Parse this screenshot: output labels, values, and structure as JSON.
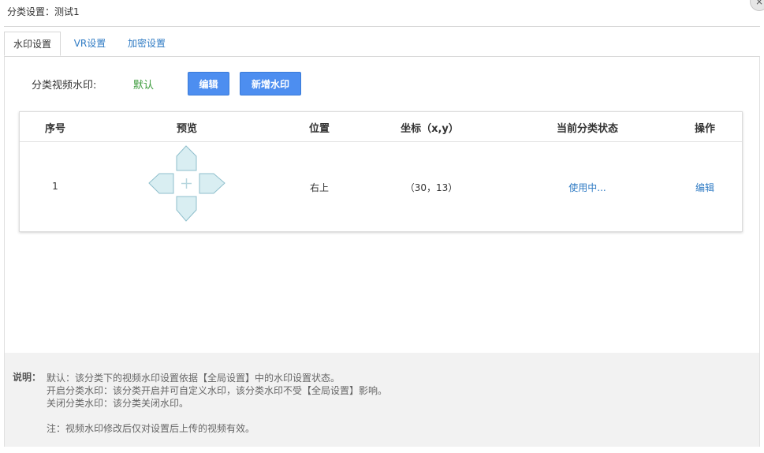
{
  "dialog": {
    "title": "分类设置：测试1",
    "close_icon": "×"
  },
  "tabs": [
    {
      "label": "水印设置",
      "active": true
    },
    {
      "label": "VR设置",
      "active": false
    },
    {
      "label": "加密设置",
      "active": false
    }
  ],
  "watermark": {
    "label": "分类视频水印:",
    "value": "默认",
    "edit_button": "编辑",
    "add_button": "新增水印"
  },
  "table": {
    "headers": [
      "序号",
      "预览",
      "位置",
      "坐标（x,y）",
      "当前分类状态",
      "操作"
    ],
    "rows": [
      {
        "index": "1",
        "preview_icon": "dpad-position-icon",
        "position": "右上",
        "coords": "（30，13）",
        "status": "使用中...",
        "action": "编辑"
      }
    ]
  },
  "notes": {
    "heading": "说明：",
    "lines": [
      "默认：该分类下的视频水印设置依据【全局设置】中的水印设置状态。",
      "开启分类水印：该分类开启并可自定义水印，该分类水印不受【全局设置】影响。",
      "关闭分类水印：该分类关闭水印。",
      "注：视频水印修改后仅对设置后上传的视频有效。"
    ]
  },
  "colors": {
    "primary_button": "#4d8ef0",
    "link": "#2f7bc4",
    "default_value": "#3a9a3a",
    "dpad_fill": "#d9eef2",
    "dpad_stroke": "#8fbfcc"
  }
}
